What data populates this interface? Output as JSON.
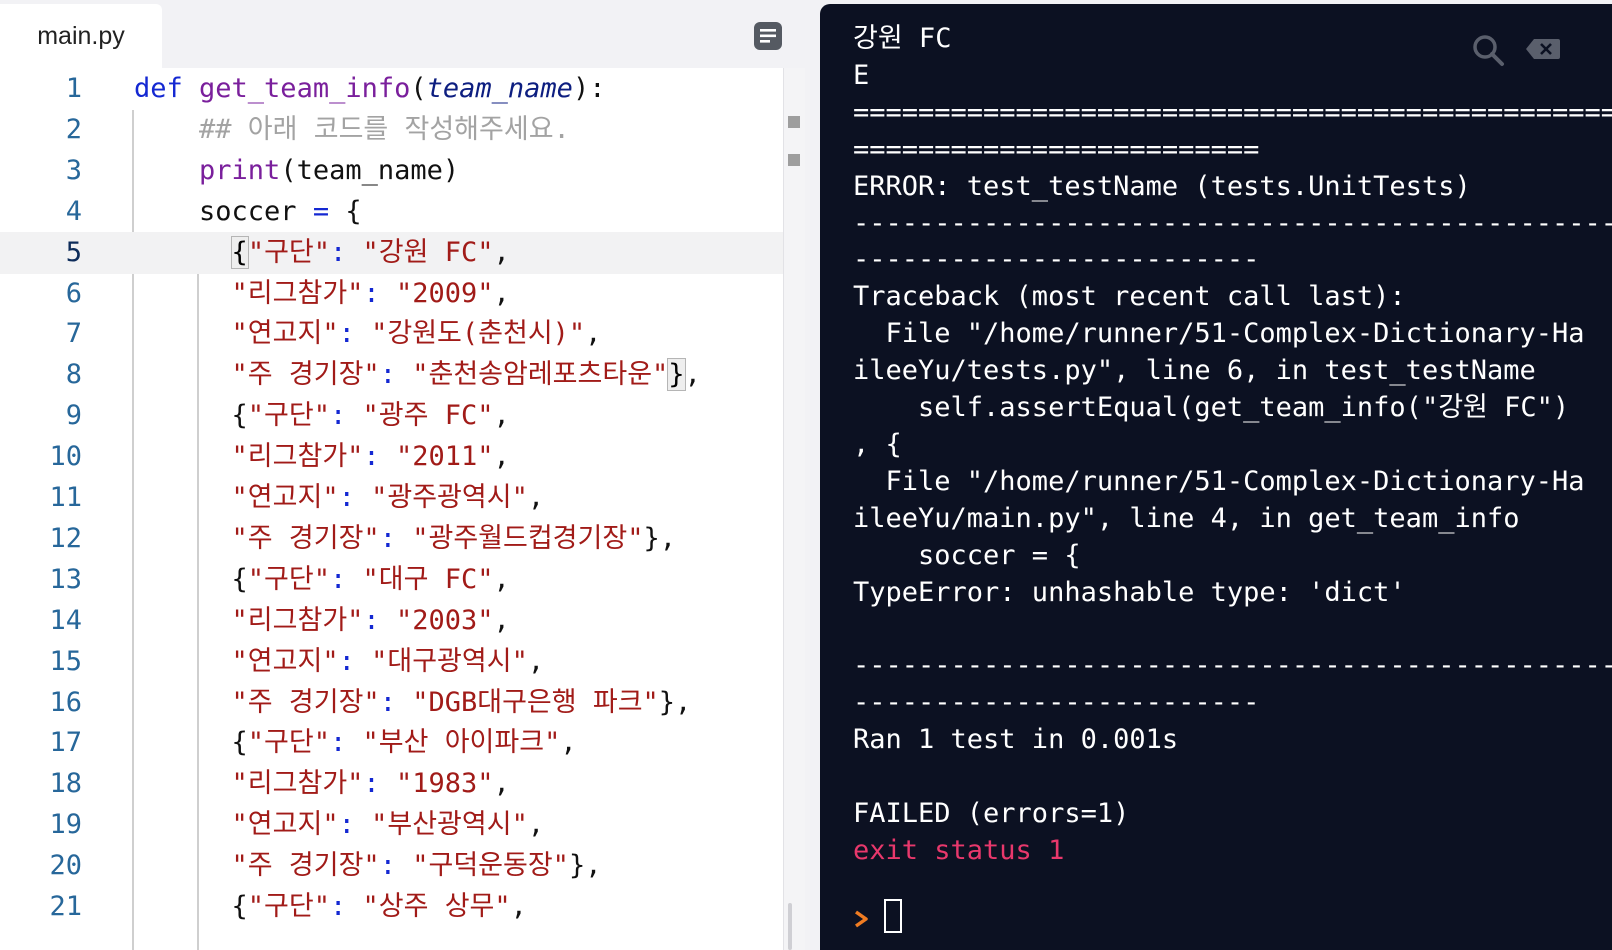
{
  "editor": {
    "tab_label": "main.py",
    "lines": [
      {
        "n": "1",
        "tokens": [
          [
            "kw",
            "def "
          ],
          [
            "fn",
            "get_team_info"
          ],
          [
            "pl",
            "("
          ],
          [
            "param",
            "team_name"
          ],
          [
            "pl",
            "):"
          ]
        ]
      },
      {
        "n": "2",
        "tokens": [
          [
            "cmt",
            "    ## 아래 코드를 작성해주세요."
          ]
        ]
      },
      {
        "n": "3",
        "tokens": [
          [
            "fn",
            "    print"
          ],
          [
            "pl",
            "(team_name)"
          ]
        ]
      },
      {
        "n": "4",
        "tokens": [
          [
            "pl",
            "    soccer "
          ],
          [
            "op",
            "="
          ],
          [
            "pl",
            " {"
          ]
        ]
      },
      {
        "n": "5",
        "tokens": [
          [
            "pl",
            "      "
          ],
          [
            "brk",
            "{"
          ],
          [
            "str",
            "\"구단\""
          ],
          [
            "op",
            ":"
          ],
          [
            "pl",
            " "
          ],
          [
            "str",
            "\"강원 FC\""
          ],
          [
            "pl",
            ","
          ]
        ]
      },
      {
        "n": "6",
        "tokens": [
          [
            "pl",
            "      "
          ],
          [
            "str",
            "\"리그참가\""
          ],
          [
            "op",
            ":"
          ],
          [
            "pl",
            " "
          ],
          [
            "str",
            "\"2009\""
          ],
          [
            "pl",
            ","
          ]
        ]
      },
      {
        "n": "7",
        "tokens": [
          [
            "pl",
            "      "
          ],
          [
            "str",
            "\"연고지\""
          ],
          [
            "op",
            ":"
          ],
          [
            "pl",
            " "
          ],
          [
            "str",
            "\"강원도(춘천시)\""
          ],
          [
            "pl",
            ","
          ]
        ]
      },
      {
        "n": "8",
        "tokens": [
          [
            "pl",
            "      "
          ],
          [
            "str",
            "\"주 경기장\""
          ],
          [
            "op",
            ":"
          ],
          [
            "pl",
            " "
          ],
          [
            "str",
            "\"춘천송암레포츠타운\""
          ],
          [
            "brk",
            "}"
          ],
          [
            "pl",
            ","
          ]
        ]
      },
      {
        "n": "9",
        "tokens": [
          [
            "pl",
            "      {"
          ],
          [
            "str",
            "\"구단\""
          ],
          [
            "op",
            ":"
          ],
          [
            "pl",
            " "
          ],
          [
            "str",
            "\"광주 FC\""
          ],
          [
            "pl",
            ","
          ]
        ]
      },
      {
        "n": "10",
        "tokens": [
          [
            "pl",
            "      "
          ],
          [
            "str",
            "\"리그참가\""
          ],
          [
            "op",
            ":"
          ],
          [
            "pl",
            " "
          ],
          [
            "str",
            "\"2011\""
          ],
          [
            "pl",
            ","
          ]
        ]
      },
      {
        "n": "11",
        "tokens": [
          [
            "pl",
            "      "
          ],
          [
            "str",
            "\"연고지\""
          ],
          [
            "op",
            ":"
          ],
          [
            "pl",
            " "
          ],
          [
            "str",
            "\"광주광역시\""
          ],
          [
            "pl",
            ","
          ]
        ]
      },
      {
        "n": "12",
        "tokens": [
          [
            "pl",
            "      "
          ],
          [
            "str",
            "\"주 경기장\""
          ],
          [
            "op",
            ":"
          ],
          [
            "pl",
            " "
          ],
          [
            "str",
            "\"광주월드컵경기장\""
          ],
          [
            "pl",
            "},"
          ]
        ]
      },
      {
        "n": "13",
        "tokens": [
          [
            "pl",
            "      {"
          ],
          [
            "str",
            "\"구단\""
          ],
          [
            "op",
            ":"
          ],
          [
            "pl",
            " "
          ],
          [
            "str",
            "\"대구 FC\""
          ],
          [
            "pl",
            ","
          ]
        ]
      },
      {
        "n": "14",
        "tokens": [
          [
            "pl",
            "      "
          ],
          [
            "str",
            "\"리그참가\""
          ],
          [
            "op",
            ":"
          ],
          [
            "pl",
            " "
          ],
          [
            "str",
            "\"2003\""
          ],
          [
            "pl",
            ","
          ]
        ]
      },
      {
        "n": "15",
        "tokens": [
          [
            "pl",
            "      "
          ],
          [
            "str",
            "\"연고지\""
          ],
          [
            "op",
            ":"
          ],
          [
            "pl",
            " "
          ],
          [
            "str",
            "\"대구광역시\""
          ],
          [
            "pl",
            ","
          ]
        ]
      },
      {
        "n": "16",
        "tokens": [
          [
            "pl",
            "      "
          ],
          [
            "str",
            "\"주 경기장\""
          ],
          [
            "op",
            ":"
          ],
          [
            "pl",
            " "
          ],
          [
            "str",
            "\"DGB대구은행 파크\""
          ],
          [
            "pl",
            "},"
          ]
        ]
      },
      {
        "n": "17",
        "tokens": [
          [
            "pl",
            "      {"
          ],
          [
            "str",
            "\"구단\""
          ],
          [
            "op",
            ":"
          ],
          [
            "pl",
            " "
          ],
          [
            "str",
            "\"부산 아이파크\""
          ],
          [
            "pl",
            ","
          ]
        ]
      },
      {
        "n": "18",
        "tokens": [
          [
            "pl",
            "      "
          ],
          [
            "str",
            "\"리그참가\""
          ],
          [
            "op",
            ":"
          ],
          [
            "pl",
            " "
          ],
          [
            "str",
            "\"1983\""
          ],
          [
            "pl",
            ","
          ]
        ]
      },
      {
        "n": "19",
        "tokens": [
          [
            "pl",
            "      "
          ],
          [
            "str",
            "\"연고지\""
          ],
          [
            "op",
            ":"
          ],
          [
            "pl",
            " "
          ],
          [
            "str",
            "\"부산광역시\""
          ],
          [
            "pl",
            ","
          ]
        ]
      },
      {
        "n": "20",
        "tokens": [
          [
            "pl",
            "      "
          ],
          [
            "str",
            "\"주 경기장\""
          ],
          [
            "op",
            ":"
          ],
          [
            "pl",
            " "
          ],
          [
            "str",
            "\"구덕운동장\""
          ],
          [
            "pl",
            "},"
          ]
        ]
      },
      {
        "n": "21",
        "tokens": [
          [
            "pl",
            "      {"
          ],
          [
            "str",
            "\"구단\""
          ],
          [
            "op",
            ":"
          ],
          [
            "pl",
            " "
          ],
          [
            "str",
            "\"상주 상무\""
          ],
          [
            "pl",
            ","
          ]
        ]
      }
    ]
  },
  "terminal": {
    "lines": [
      "강원 FC",
      "E",
      "============================================================",
      "=========================",
      "ERROR: test_testName (tests.UnitTests)",
      "------------------------------------------------------------",
      "-------------------------",
      "Traceback (most recent call last):",
      "  File \"/home/runner/51-Complex-Dictionary-Ha",
      "ileeYu/tests.py\", line 6, in test_testName",
      "    self.assertEqual(get_team_info(\"강원 FC\")",
      ", {",
      "  File \"/home/runner/51-Complex-Dictionary-Ha",
      "ileeYu/main.py\", line 4, in get_team_info",
      "    soccer = {",
      "TypeError: unhashable type: 'dict'",
      "",
      "------------------------------------------------------------",
      "-------------------------",
      "Ran 1 test in 0.001s",
      "",
      "FAILED (errors=1)"
    ],
    "exit_status": "exit status 1",
    "colors": {
      "background": "#0c1122",
      "error": "#e8386c",
      "prompt": "#f07c22"
    }
  }
}
